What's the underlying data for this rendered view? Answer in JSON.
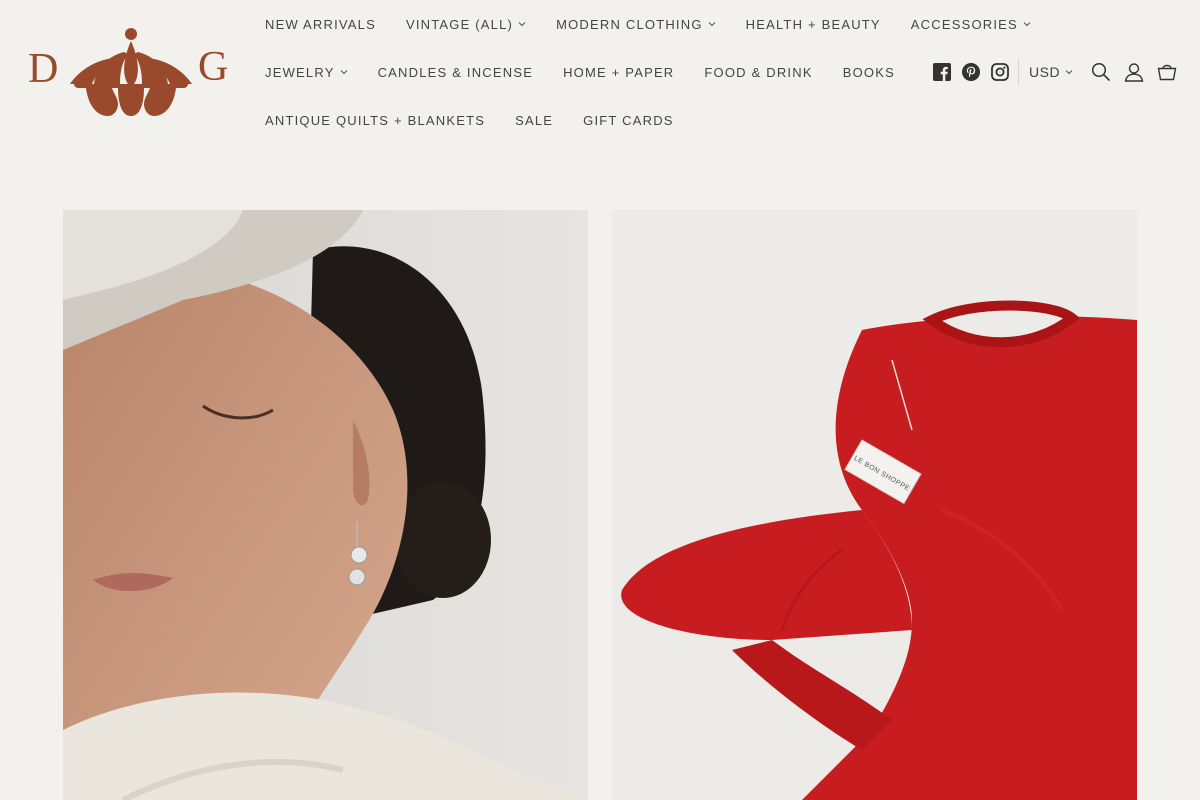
{
  "brand": {
    "logo_left_letter": "D",
    "logo_right_letter": "G",
    "accent": "#9a4a2c"
  },
  "nav": {
    "rows": [
      [
        {
          "label": "NEW ARRIVALS",
          "dropdown": false
        },
        {
          "label": "VINTAGE (ALL)",
          "dropdown": true
        },
        {
          "label": "MODERN CLOTHING",
          "dropdown": true
        },
        {
          "label": "HEALTH + BEAUTY",
          "dropdown": false
        },
        {
          "label": "ACCESSORIES",
          "dropdown": true
        }
      ],
      [
        {
          "label": "JEWELRY",
          "dropdown": true
        },
        {
          "label": "CANDLES & INCENSE",
          "dropdown": false
        },
        {
          "label": "HOME + PAPER",
          "dropdown": false
        },
        {
          "label": "FOOD & DRINK",
          "dropdown": false
        },
        {
          "label": "BOOKS",
          "dropdown": false
        }
      ],
      [
        {
          "label": "ANTIQUE QUILTS + BLANKETS",
          "dropdown": false
        },
        {
          "label": "SALE",
          "dropdown": false
        },
        {
          "label": "GIFT CARDS",
          "dropdown": false
        }
      ]
    ]
  },
  "header_utils": {
    "social": [
      "facebook-icon",
      "pinterest-icon",
      "instagram-icon"
    ],
    "currency": "USD",
    "actions": [
      "search-icon",
      "account-icon",
      "cart-icon"
    ]
  },
  "hero_tiles": [
    {
      "image": "portrait-woman-silver-earring"
    },
    {
      "image": "red-mohair-sweater",
      "tag_text": "LE BON SHOPPE"
    }
  ]
}
